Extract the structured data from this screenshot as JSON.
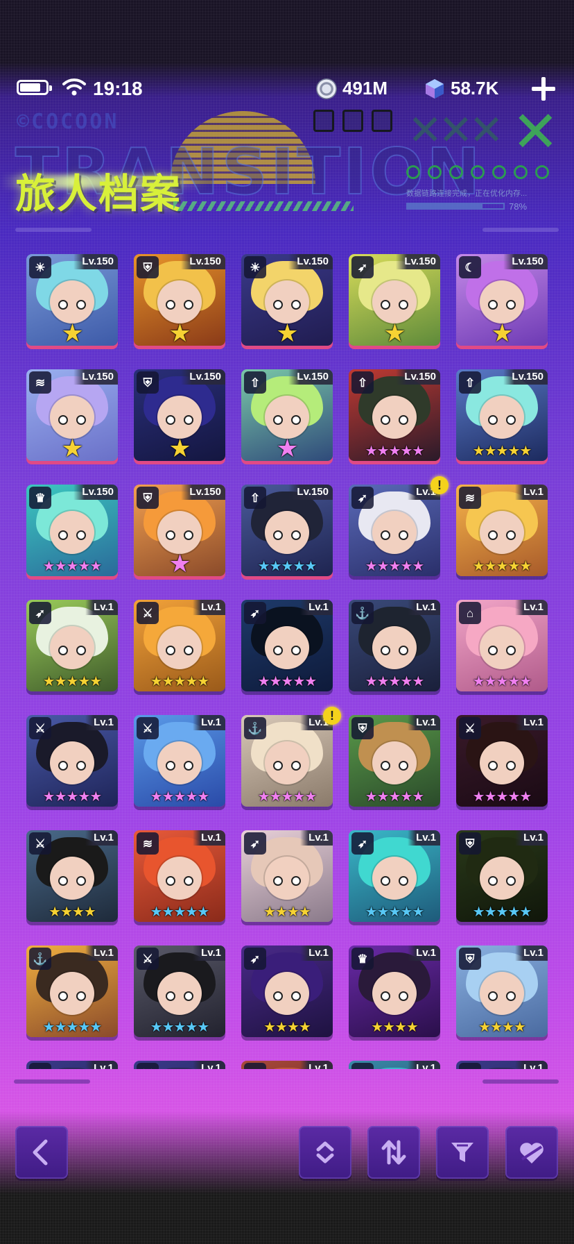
{
  "status_bar": {
    "time": "19:18",
    "coins": "491M",
    "gems": "58.7K",
    "battery_level": 0.8
  },
  "header": {
    "title": "旅人档案",
    "logo_text": "©COCOON",
    "background_word": "TRANSITION",
    "loading_text": "数据链路连接完成，正在优化内存...",
    "loading_percent": "78%",
    "loading_progress": 0.78
  },
  "icons": {
    "battery": "battery-icon",
    "wifi": "wifi-icon",
    "coin": "coin-icon",
    "gem": "gem-icon",
    "add": "plus-icon",
    "back": "back-arrow-icon",
    "expand": "expand-collapse-icon",
    "sort": "sort-icon",
    "filter": "filter-icon",
    "favorite": "heart-icon"
  },
  "colors": {
    "title": "#d8f03a",
    "star_gold": "#f6d233",
    "star_pink": "#f080f0",
    "star_blue": "#58c8f6",
    "alert": "#f4d21c",
    "maxed_border": "#e04a86"
  },
  "characters": [
    {
      "level": "Lv.150",
      "class": "sun",
      "stars": 1,
      "star_color": "gold",
      "bg": [
        "#7a9ad8",
        "#3d5aa8"
      ],
      "hair": "#7fd8e6"
    },
    {
      "level": "Lv.150",
      "class": "shield",
      "stars": 1,
      "star_color": "gold",
      "bg": [
        "#e8942a",
        "#8a3a18"
      ],
      "hair": "#f2c14a"
    },
    {
      "level": "Lv.150",
      "class": "sun",
      "stars": 1,
      "star_color": "gold",
      "bg": [
        "#3a3a8a",
        "#201c50"
      ],
      "hair": "#f3d46a"
    },
    {
      "level": "Lv.150",
      "class": "bow",
      "stars": 1,
      "star_color": "gold",
      "bg": [
        "#d8dc5a",
        "#5e8a3a"
      ],
      "hair": "#e6e88a"
    },
    {
      "level": "Lv.150",
      "class": "moon",
      "stars": 1,
      "star_color": "gold",
      "bg": [
        "#c58ae8",
        "#6d3ab4"
      ],
      "hair": "#c070e8"
    },
    {
      "level": "Lv.150",
      "class": "wave",
      "stars": 1,
      "star_color": "gold",
      "bg": [
        "#9ab0f0",
        "#6a70c8"
      ],
      "hair": "#b6a6f2"
    },
    {
      "level": "Lv.150",
      "class": "shield",
      "stars": 1,
      "star_color": "gold",
      "bg": [
        "#2a2f7a",
        "#141640"
      ],
      "hair": "#2e2b8f"
    },
    {
      "level": "Lv.150",
      "class": "arrow",
      "stars": 1,
      "star_color": "pink",
      "bg": [
        "#7ac8a8",
        "#2f4a7a"
      ],
      "hair": "#b5ec7a"
    },
    {
      "level": "Lv.150",
      "class": "arrow",
      "stars": 5,
      "star_color": "pink",
      "bg": [
        "#c03a32",
        "#2a1a2a"
      ],
      "hair": "#2f3a2a"
    },
    {
      "level": "Lv.150",
      "class": "arrow",
      "stars": 5,
      "star_color": "gold",
      "bg": [
        "#5a7ac8",
        "#1c2a5e"
      ],
      "hair": "#8ae8e0"
    },
    {
      "level": "Lv.150",
      "class": "crown",
      "stars": 5,
      "star_color": "pink",
      "bg": [
        "#3cc8c0",
        "#2a6a9a"
      ],
      "hair": "#7ce8d8"
    },
    {
      "level": "Lv.150",
      "class": "shield",
      "stars": 1,
      "star_color": "pink",
      "bg": [
        "#f2a050",
        "#8a4a2a"
      ],
      "hair": "#f59a3a"
    },
    {
      "level": "Lv.150",
      "class": "arrow",
      "stars": 5,
      "star_color": "blue",
      "bg": [
        "#4a5a9a",
        "#1e2450"
      ],
      "hair": "#202438"
    },
    {
      "level": "Lv.1",
      "class": "bow",
      "stars": 5,
      "star_color": "pink",
      "alert": "!",
      "bg": [
        "#5a6ab8",
        "#2a2f6a"
      ],
      "hair": "#e8e8f2"
    },
    {
      "level": "Lv.1",
      "class": "wave",
      "stars": 5,
      "star_color": "gold",
      "bg": [
        "#f6b44a",
        "#a85a2a"
      ],
      "hair": "#f6c650"
    },
    {
      "level": "Lv.1",
      "class": "bow",
      "stars": 5,
      "star_color": "gold",
      "bg": [
        "#9acb5a",
        "#3e5a2a"
      ],
      "hair": "#e8f2e0"
    },
    {
      "level": "Lv.1",
      "class": "sword",
      "stars": 5,
      "star_color": "gold",
      "bg": [
        "#f2a23a",
        "#9a5a1a"
      ],
      "hair": "#f5a83a"
    },
    {
      "level": "Lv.1",
      "class": "bow",
      "stars": 5,
      "star_color": "pink",
      "bg": [
        "#1e3a6a",
        "#0e1a3a"
      ],
      "hair": "#0a1220"
    },
    {
      "level": "Lv.1",
      "class": "anchor",
      "stars": 5,
      "star_color": "pink",
      "bg": [
        "#3a4a7a",
        "#1a1f3a"
      ],
      "hair": "#1e2430"
    },
    {
      "level": "Lv.1",
      "class": "home",
      "stars": 5,
      "star_color": "pink",
      "bg": [
        "#f2a6c8",
        "#b05a8a"
      ],
      "hair": "#f6a8c4"
    },
    {
      "level": "Lv.1",
      "class": "sword",
      "stars": 5,
      "star_color": "pink",
      "bg": [
        "#4a5aa8",
        "#1e2458"
      ],
      "hair": "#1a1a2a"
    },
    {
      "level": "Lv.1",
      "class": "sword",
      "stars": 5,
      "star_color": "pink",
      "bg": [
        "#5a9ae8",
        "#2a4aa8"
      ],
      "hair": "#6aaaf0"
    },
    {
      "level": "Lv.1",
      "class": "anchor",
      "stars": 5,
      "star_color": "pink",
      "alert": "!",
      "bg": [
        "#d8c8b8",
        "#8a7a6a"
      ],
      "hair": "#f0e0c8"
    },
    {
      "level": "Lv.1",
      "class": "shield",
      "stars": 5,
      "star_color": "pink",
      "bg": [
        "#5a9a4a",
        "#2a4a2a"
      ],
      "hair": "#c09050"
    },
    {
      "level": "Lv.1",
      "class": "sword",
      "stars": 5,
      "star_color": "pink",
      "bg": [
        "#3a1a2a",
        "#1a0a14"
      ],
      "hair": "#2a1414"
    },
    {
      "level": "Lv.1",
      "class": "sword",
      "stars": 4,
      "star_color": "gold",
      "bg": [
        "#4a6a8a",
        "#1e2a3a"
      ],
      "hair": "#1a1a1a"
    },
    {
      "level": "Lv.1",
      "class": "wave",
      "stars": 5,
      "star_color": "blue",
      "bg": [
        "#e85a3a",
        "#8a2a1a"
      ],
      "hair": "#e8552e"
    },
    {
      "level": "Lv.1",
      "class": "bow",
      "stars": 4,
      "star_color": "gold",
      "bg": [
        "#e8d0d8",
        "#8a7a8a"
      ],
      "hair": "#e6c8b8"
    },
    {
      "level": "Lv.1",
      "class": "bow",
      "stars": 5,
      "star_color": "blue",
      "bg": [
        "#3ab8c8",
        "#1e5a7a"
      ],
      "hair": "#40d8d0"
    },
    {
      "level": "Lv.1",
      "class": "shield",
      "stars": 5,
      "star_color": "blue",
      "bg": [
        "#2a3a1a",
        "#10160a"
      ],
      "hair": "#202a12"
    },
    {
      "level": "Lv.1",
      "class": "anchor",
      "stars": 5,
      "star_color": "blue",
      "bg": [
        "#f0b040",
        "#8a4a2a"
      ],
      "hair": "#3a2a20"
    },
    {
      "level": "Lv.1",
      "class": "sword",
      "stars": 5,
      "star_color": "blue",
      "bg": [
        "#5a5a6a",
        "#22222e"
      ],
      "hair": "#1a1a1e"
    },
    {
      "level": "Lv.1",
      "class": "bow",
      "stars": 4,
      "star_color": "gold",
      "bg": [
        "#4a2a8a",
        "#1e1240"
      ],
      "hair": "#3a1e7a"
    },
    {
      "level": "Lv.1",
      "class": "crown",
      "stars": 4,
      "star_color": "gold",
      "bg": [
        "#6a2aa8",
        "#2a0f4a"
      ],
      "hair": "#2a1a3a"
    },
    {
      "level": "Lv.1",
      "class": "shield",
      "stars": 4,
      "star_color": "gold",
      "bg": [
        "#8ab0e0",
        "#4a6aa0"
      ],
      "hair": "#a8d0f2"
    },
    {
      "level": "Lv.1",
      "class": "arrow",
      "stars": 0,
      "star_color": "gold",
      "bg": [
        "#3a3a8a",
        "#1a1a40"
      ],
      "hair": "#2a2a5a"
    },
    {
      "level": "Lv.1",
      "class": "sword",
      "stars": 0,
      "star_color": "gold",
      "bg": [
        "#3a3a8a",
        "#1a1a40"
      ],
      "hair": "#2a2a5a"
    },
    {
      "level": "Lv.1",
      "class": "shield",
      "stars": 0,
      "star_color": "gold",
      "bg": [
        "#a84a3a",
        "#5a1a1a"
      ],
      "hair": "#c05a3a"
    },
    {
      "level": "Lv.1",
      "class": "bow",
      "stars": 0,
      "star_color": "gold",
      "bg": [
        "#3a8aa8",
        "#1a3a5a"
      ],
      "hair": "#3ab8c8"
    },
    {
      "level": "Lv.1",
      "class": "wave",
      "stars": 0,
      "star_color": "gold",
      "bg": [
        "#3a3a8a",
        "#1a1a40"
      ],
      "hair": "#2a2a5a"
    }
  ]
}
